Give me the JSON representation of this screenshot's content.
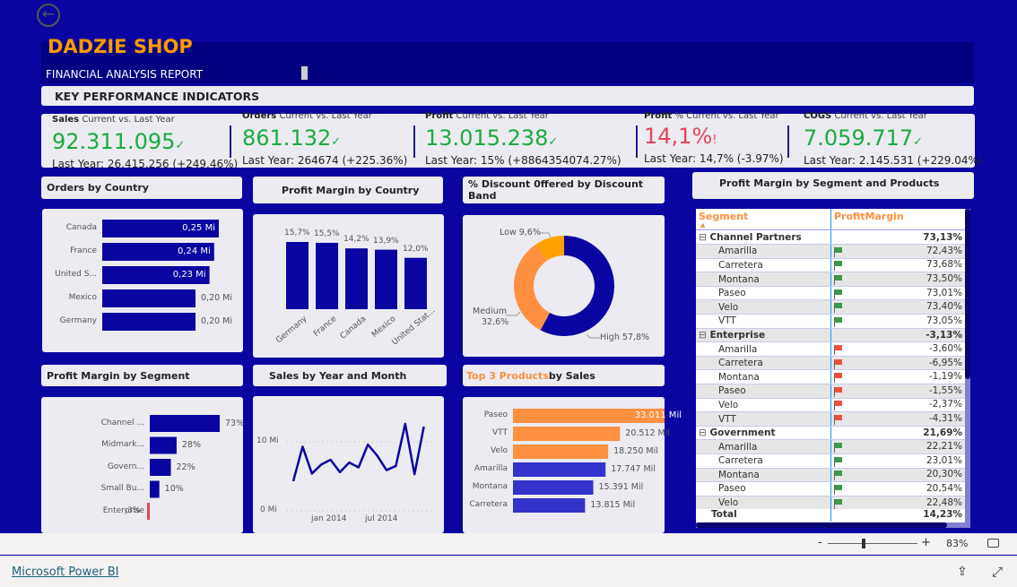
{
  "header": {
    "back_icon": "arrow-left-circle-icon",
    "brand": "DADZIE SHOP",
    "subtitle": "FINANCIAL ANALYSIS REPORT",
    "kpi_section": "KEY PERFORMANCE INDICATORS"
  },
  "colors": {
    "background": "#0a05a0",
    "bar": "#0a05a0",
    "good": "#1aab40",
    "bad": "#e0465c",
    "orange": "#ff9040",
    "orange_dark": "#ffa000",
    "bar_blue": "#3333cc",
    "brand": "#ff9a00"
  },
  "kpis": [
    {
      "name": "Sales",
      "suffix": "Current vs. Last Year",
      "value": "92.311.095",
      "indicator": "✓",
      "last_year": "Last Year: 26.415.256 (+249.46%)",
      "status": "good"
    },
    {
      "name": "Orders",
      "suffix": "Current vs. Last Year",
      "value": "861.132",
      "indicator": "✓",
      "last_year": "Last Year: 264674 (+225.36%)",
      "status": "good"
    },
    {
      "name": "Profit",
      "suffix": "Current vs. Last Year",
      "value": "13.015.238",
      "indicator": "✓",
      "last_year": "Last Year: 15% (+8864354074.27%)",
      "status": "good"
    },
    {
      "name": "Profit",
      "suffix": "% Current vs. Last Year",
      "value": "14,1%",
      "indicator": "!",
      "last_year": "Last Year: 14,7% (-3.97%)",
      "status": "bad"
    },
    {
      "name": "COGS",
      "suffix": "Current vs. Last Year",
      "value": "7.059.717",
      "indicator": "✓",
      "last_year": "Last Year: 2.145.531 (+229.04%)",
      "status": "good"
    }
  ],
  "titles": {
    "orders_by_country": "Orders by Country",
    "pm_by_country": "Profit Margin by Country",
    "discount": "% Discount 0ffered by Discount Band",
    "pm_segment_products": "Profit Margin by Segment and Products",
    "pm_by_segment": "Profit Margin by Segment",
    "sales_by_month": "Sales by Year and Month",
    "top3_prefix": "Top 3 Products",
    "top3_suffix": " by Sales"
  },
  "chart_data": [
    {
      "id": "orders_by_country",
      "type": "bar",
      "orientation": "horizontal",
      "categories": [
        "Canada",
        "France",
        "United S...",
        "Mexico",
        "Germany"
      ],
      "values": [
        0.25,
        0.24,
        0.23,
        0.2,
        0.2
      ],
      "labels": [
        "0,25 Mi",
        "0,24 Mi",
        "0,23 Mi",
        "0,20 Mi",
        "0,20 Mi"
      ]
    },
    {
      "id": "pm_by_country",
      "type": "bar",
      "categories": [
        "Germany",
        "France",
        "Canada",
        "Mexico",
        "United Stat..."
      ],
      "values": [
        15.7,
        15.5,
        14.2,
        13.9,
        12.0
      ],
      "labels": [
        "15,7%",
        "15,5%",
        "14,2%",
        "13,9%",
        "12,0%"
      ]
    },
    {
      "id": "discount",
      "type": "pie",
      "donut": true,
      "categories": [
        "High",
        "Medium",
        "Low"
      ],
      "values": [
        57.8,
        32.6,
        9.6
      ],
      "labels": [
        "High 57,8%",
        "Medium",
        "32,6%",
        "Low 9,6%"
      ],
      "colors": [
        "#0a05a0",
        "#ff9040",
        "#ffa000"
      ]
    },
    {
      "id": "pm_by_segment",
      "type": "bar",
      "orientation": "horizontal",
      "categories": [
        "Channel ...",
        "Midmark...",
        "Govern...",
        "Small Bu...",
        "Enterprise"
      ],
      "values": [
        73,
        28,
        22,
        10,
        -3
      ],
      "labels": [
        "73%",
        "28%",
        "22%",
        "10%",
        "-3%"
      ]
    },
    {
      "id": "sales_by_month",
      "type": "line",
      "x": [
        "2013-09",
        "2013-10",
        "2013-11",
        "2013-12",
        "2014-01",
        "2014-02",
        "2014-03",
        "2014-04",
        "2014-05",
        "2014-06",
        "2014-07",
        "2014-08",
        "2014-09",
        "2014-10",
        "2014-11"
      ],
      "values": [
        4.3,
        9.3,
        5.4,
        6.7,
        7.4,
        5.6,
        7.0,
        6.3,
        9.6,
        8.0,
        5.9,
        6.5,
        12.6,
        5.3,
        12.2
      ],
      "yticks": [
        "0 Mi",
        "10 Mi"
      ],
      "xticks": [
        "jan 2014",
        "jul 2014"
      ],
      "ylim": [
        0,
        15
      ],
      "grid": true
    },
    {
      "id": "top3_products",
      "type": "bar",
      "orientation": "horizontal",
      "categories": [
        "Paseo",
        "VTT",
        "Velo",
        "Amarilla",
        "Montana",
        "Carretera"
      ],
      "values": [
        33011,
        20512,
        18250,
        17747,
        15391,
        13815
      ],
      "labels": [
        "33.011 Mil",
        "20.512 Mil",
        "18.250 Mil",
        "17.747 Mil",
        "15.391 Mil",
        "13.815 Mil"
      ],
      "highlight_top": 3
    }
  ],
  "matrix": {
    "col1": "Segment",
    "col2": "ProfitMargin",
    "groups": [
      {
        "name": "Channel Partners",
        "value": "73,13%",
        "rows": [
          [
            "Amarilla",
            "72,43%",
            "good"
          ],
          [
            "Carretera",
            "73,68%",
            "good"
          ],
          [
            "Montana",
            "73,50%",
            "good"
          ],
          [
            "Paseo",
            "73,01%",
            "good"
          ],
          [
            "Velo",
            "73,40%",
            "good"
          ],
          [
            "VTT",
            "73,05%",
            "good"
          ]
        ]
      },
      {
        "name": "Enterprise",
        "value": "-3,13%",
        "rows": [
          [
            "Amarilla",
            "-3,60%",
            "bad"
          ],
          [
            "Carretera",
            "-6,95%",
            "bad"
          ],
          [
            "Montana",
            "-1,19%",
            "bad"
          ],
          [
            "Paseo",
            "-1,55%",
            "bad"
          ],
          [
            "Velo",
            "-2,37%",
            "bad"
          ],
          [
            "VTT",
            "-4,31%",
            "bad"
          ]
        ]
      },
      {
        "name": "Government",
        "value": "21,69%",
        "rows": [
          [
            "Amarilla",
            "22,21%",
            "good"
          ],
          [
            "Carretera",
            "23,01%",
            "good"
          ],
          [
            "Montana",
            "20,30%",
            "good"
          ],
          [
            "Paseo",
            "20,54%",
            "good"
          ],
          [
            "Velo",
            "22,48%",
            "good"
          ]
        ]
      }
    ],
    "total_label": "Total",
    "total_value": "14,23%"
  },
  "footer": {
    "zoom_minus": "-",
    "zoom_plus": "+",
    "zoom": "83%",
    "brand_link": "Microsoft Power BI"
  }
}
